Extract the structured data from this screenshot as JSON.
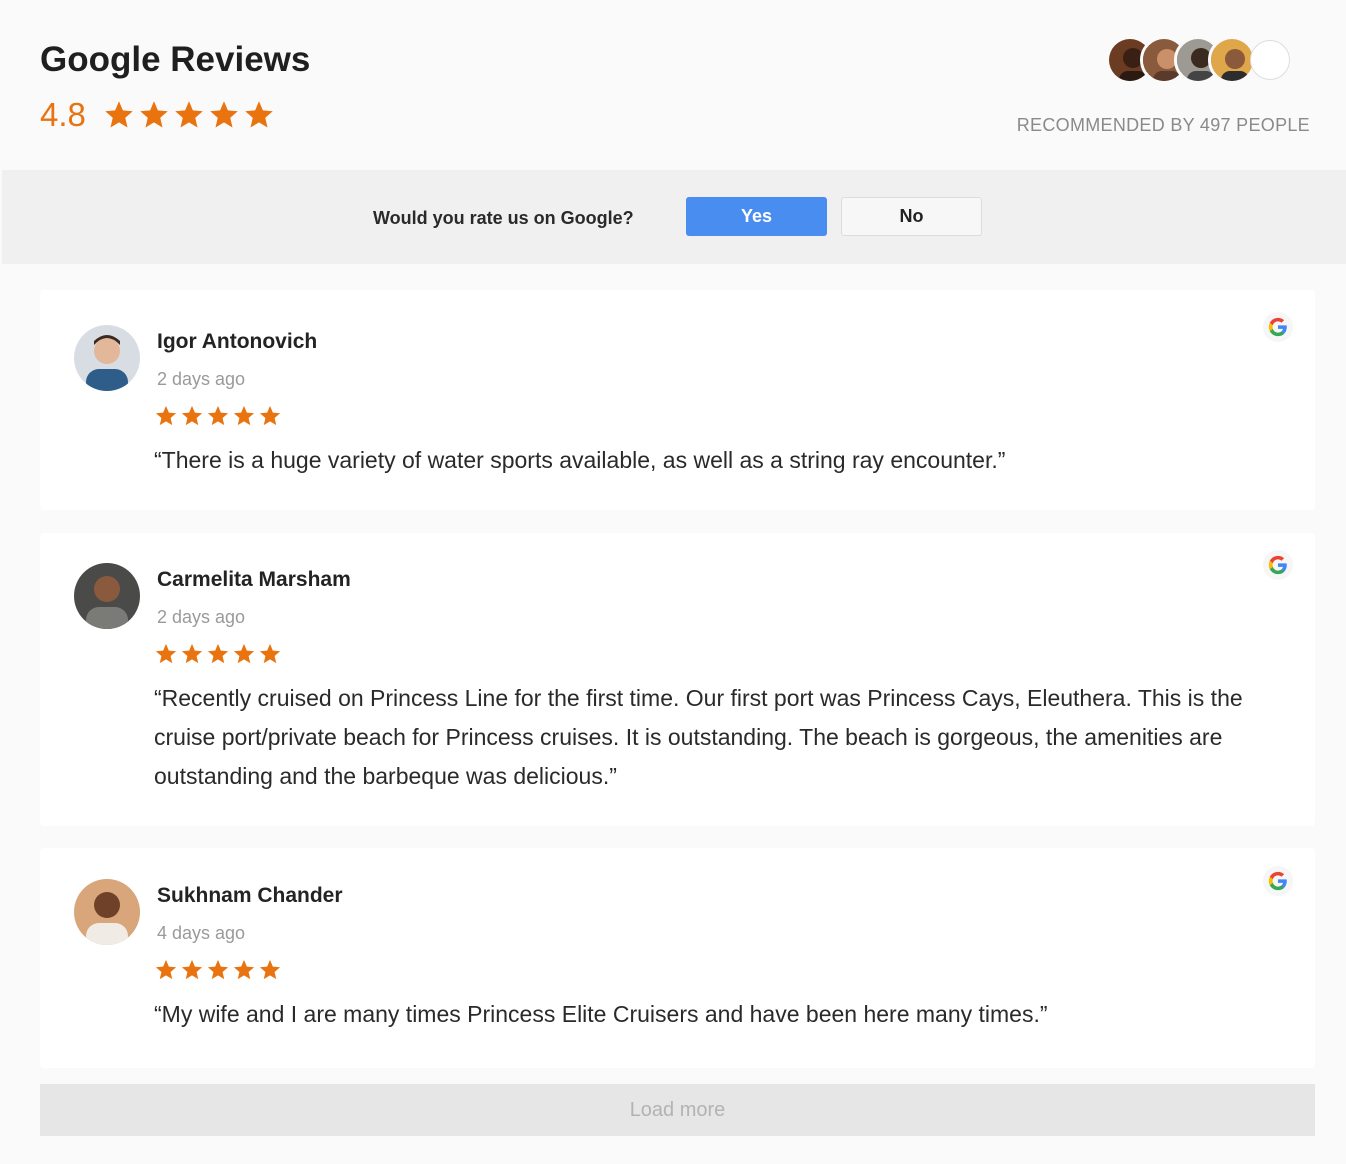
{
  "header": {
    "title": "Google Reviews",
    "rating": "4.8",
    "rating_stars": 5,
    "recommended": "RECOMMENDED BY 497 PEOPLE"
  },
  "prompt": {
    "question": "Would you rate us on Google?",
    "yes_label": "Yes",
    "no_label": "No"
  },
  "reviews": [
    {
      "name": "Igor Antonovich",
      "ago": "2 days ago",
      "stars": 5,
      "text": "“There is a huge variety of water sports available, as well as a string ray encounter.”"
    },
    {
      "name": "Carmelita Marsham",
      "ago": "2 days ago",
      "stars": 5,
      "text": "“Recently cruised on Princess Line for the first time. Our first port was Princess Cays, Eleuthera. This is the cruise port/private beach for Princess cruises. It is outstanding. The beach is gorgeous, the amenities are outstanding and the barbeque was delicious.”"
    },
    {
      "name": "Sukhnam Chander",
      "ago": "4 days ago",
      "stars": 5,
      "text": "“My wife and I are many times Princess Elite Cruisers and have been here many times.”"
    }
  ],
  "load_more_label": "Load more",
  "colors": {
    "accent_orange": "#e8730f",
    "yes_blue": "#4a8df0"
  },
  "icons": {
    "star": "star-icon",
    "google": "google-icon"
  }
}
